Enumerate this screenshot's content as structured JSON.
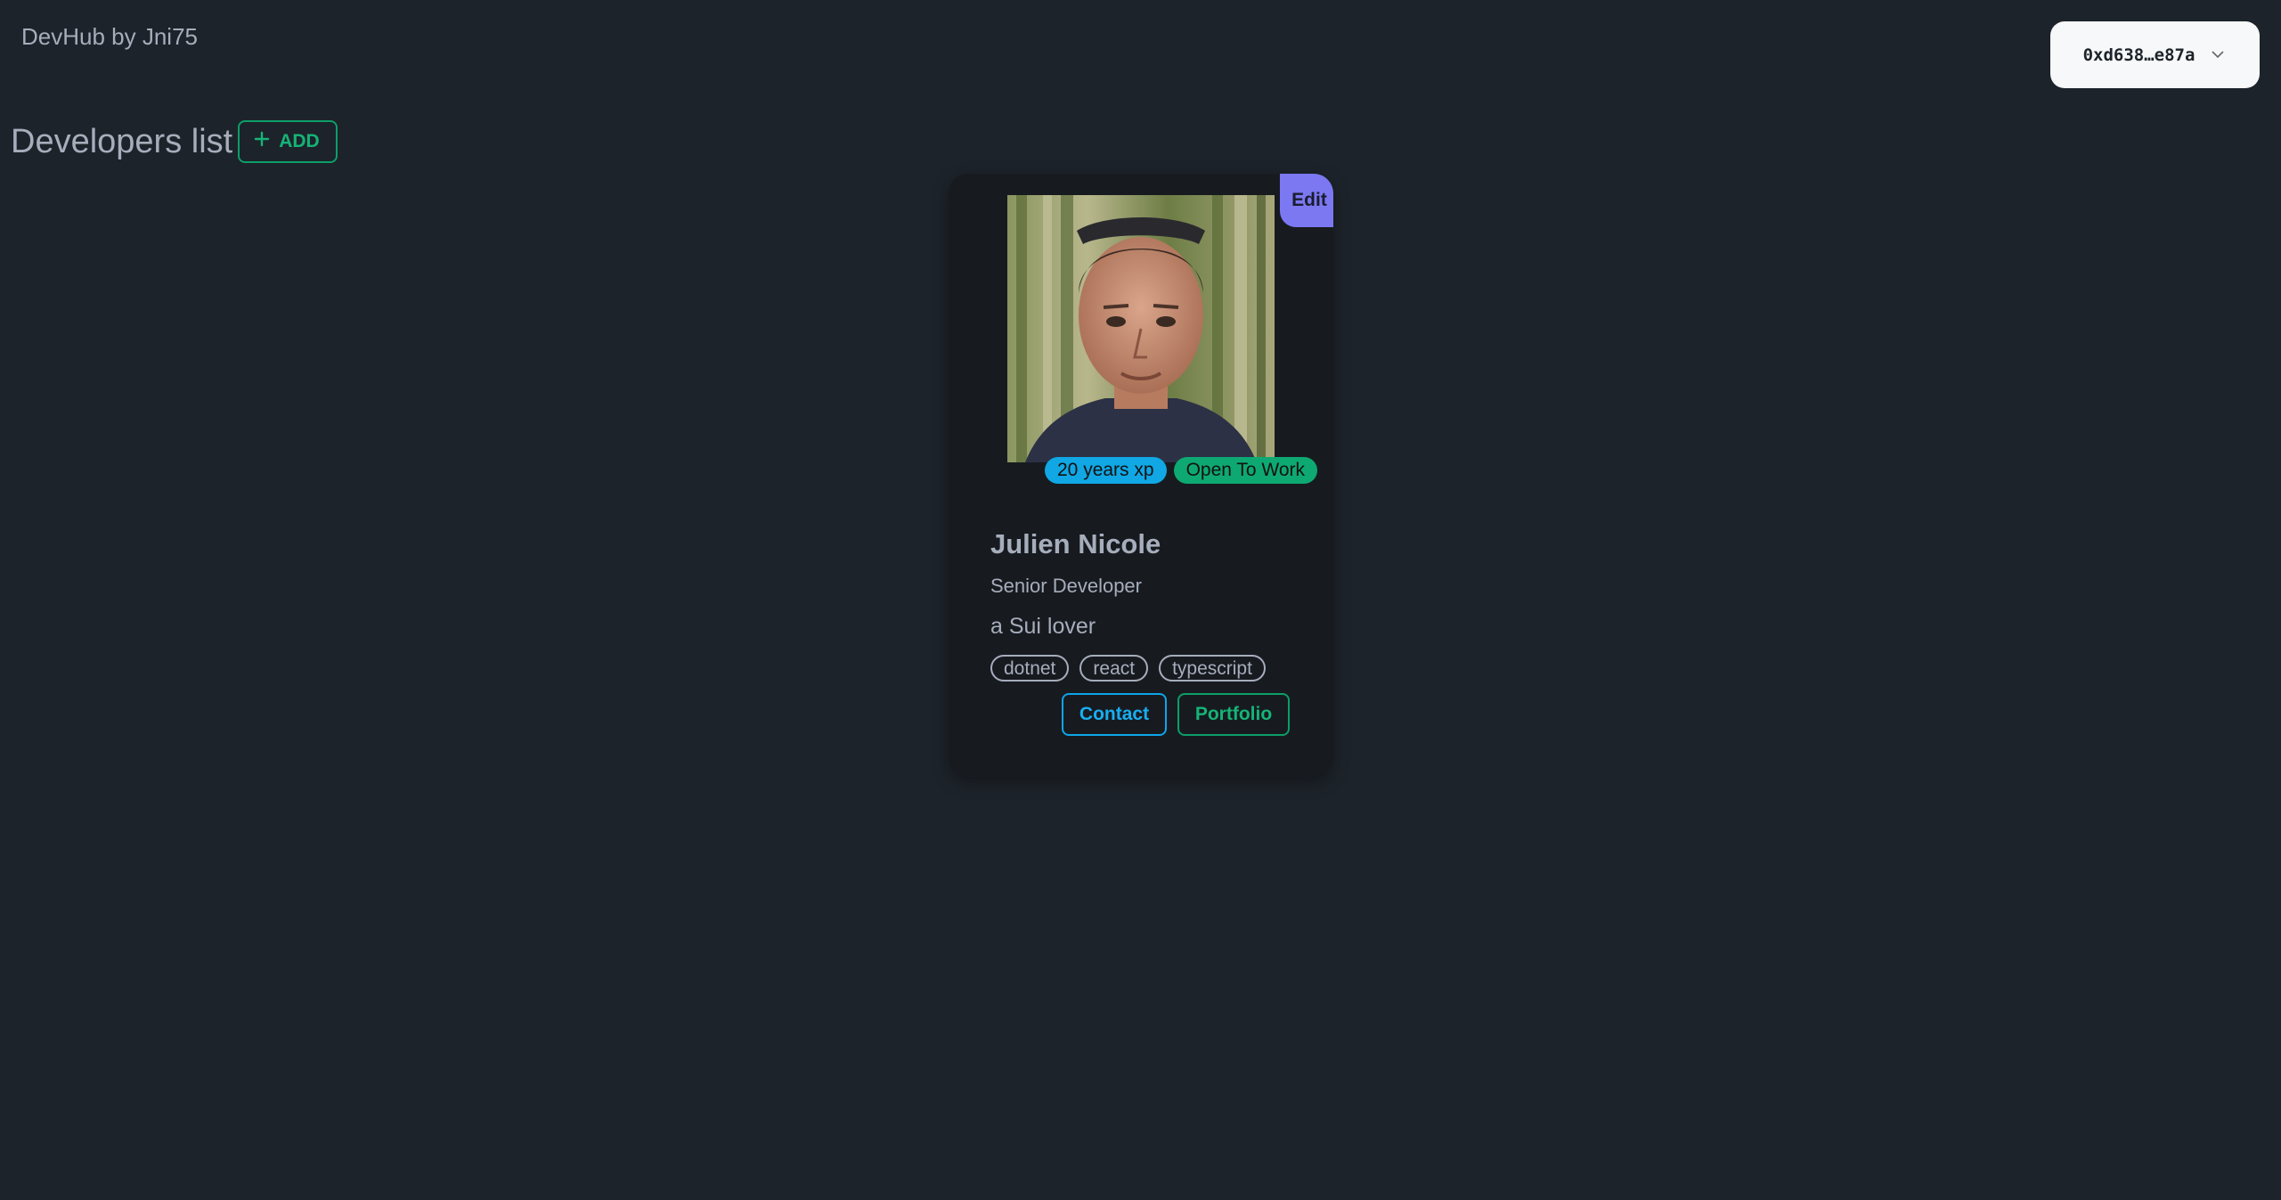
{
  "app": {
    "title": "DevHub by Jni75"
  },
  "wallet": {
    "address": "0xd638…e87a",
    "icon": "chevron-down-icon"
  },
  "list": {
    "title": "Developers list",
    "add_label": "ADD",
    "add_icon": "plus-icon"
  },
  "developers": [
    {
      "edit_label": "Edit",
      "photo_alt": "Julien Nicole",
      "experience_badge": "20 years xp",
      "status_badge": "Open To Work",
      "name": "Julien Nicole",
      "role": "Senior Developer",
      "bio": "a Sui lover",
      "skills": [
        "dotnet",
        "react",
        "typescript"
      ],
      "contact_label": "Contact",
      "portfolio_label": "Portfolio"
    }
  ],
  "colors": {
    "background": "#1d232a",
    "card": "#171b20",
    "accent_green": "#0ea972",
    "accent_blue": "#10a7e4",
    "edit_purple": "#7b78f2"
  }
}
